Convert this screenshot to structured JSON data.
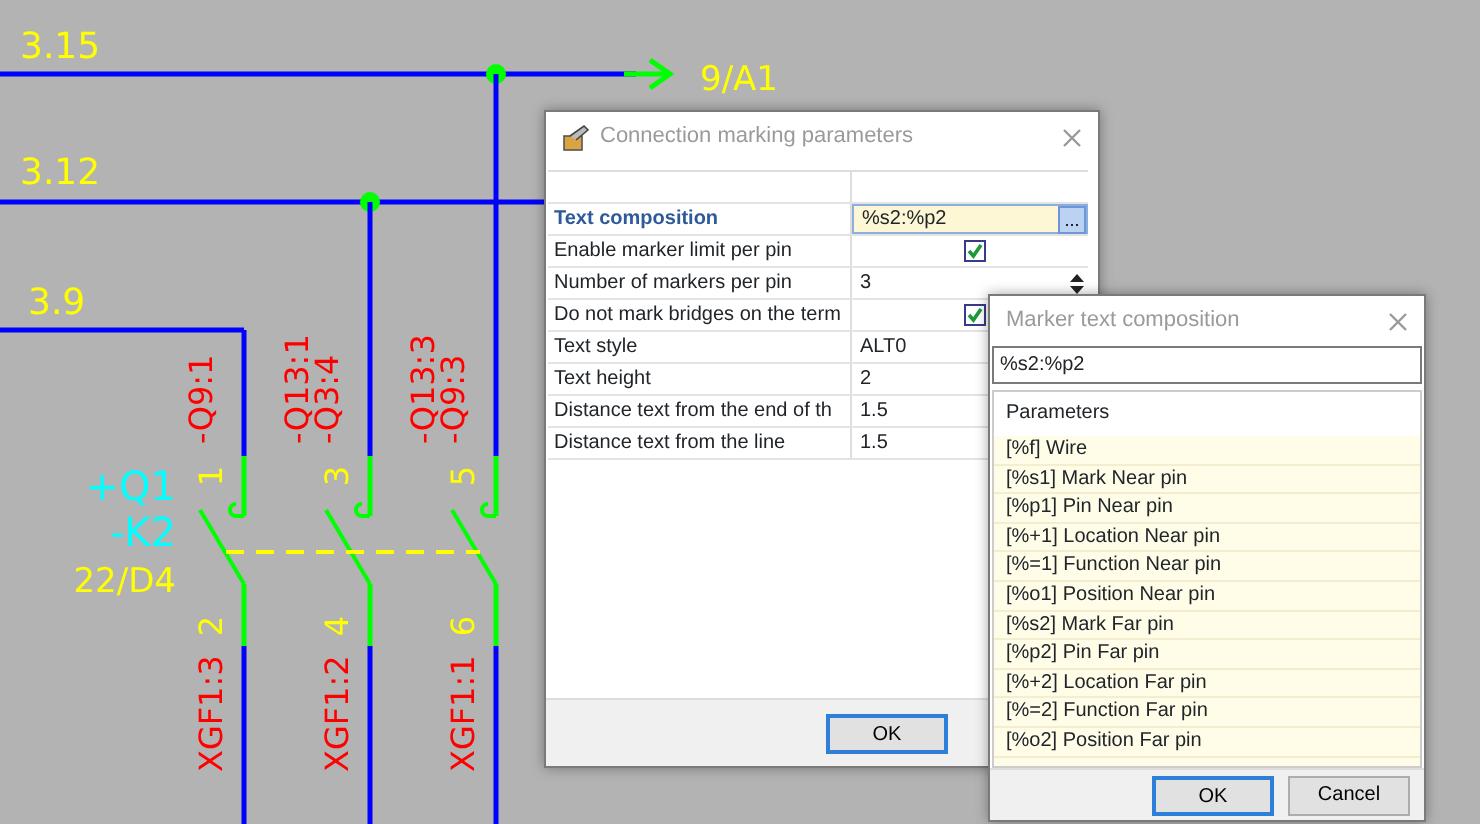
{
  "schematic": {
    "wire_labels": [
      "3.15",
      "3.12",
      "3.9"
    ],
    "cross_reference": "9/A1",
    "device": {
      "location": "+Q1",
      "name": "-K2",
      "reference": "22/D4"
    },
    "poles": [
      {
        "top_pin": "1",
        "bottom_pin": "2",
        "top_marks": [
          "-Q9:1"
        ],
        "bottom_mark": "XGF1:3"
      },
      {
        "top_pin": "3",
        "bottom_pin": "4",
        "top_marks": [
          "-Q13:1",
          "-Q3:4"
        ],
        "bottom_mark": "XGF1:2"
      },
      {
        "top_pin": "5",
        "bottom_pin": "6",
        "top_marks": [
          "-Q13:3",
          "-Q9:3"
        ],
        "bottom_mark": "XGF1:1"
      }
    ]
  },
  "parameters_dialog": {
    "title": "Connection marking parameters",
    "rows": [
      {
        "label": "Text composition",
        "value": "%s2:%p2",
        "kind": "text",
        "selected": true,
        "action_label": "..."
      },
      {
        "label": "Enable marker limit per pin",
        "kind": "checkbox",
        "checked": true,
        "selected": false
      },
      {
        "label": "Number of markers per pin",
        "value": "3",
        "kind": "spin",
        "selected": false
      },
      {
        "label": "Do not mark bridges on the term",
        "kind": "checkbox",
        "checked": true,
        "selected": false
      },
      {
        "label": "Text style",
        "value": "ALT0",
        "kind": "text",
        "selected": false
      },
      {
        "label": "Text height",
        "value": "2",
        "kind": "text",
        "selected": false
      },
      {
        "label": "Distance text from the end of th",
        "value": "1.5",
        "kind": "text",
        "selected": false
      },
      {
        "label": "Distance text from the line",
        "value": "1.5",
        "kind": "text",
        "selected": false
      }
    ],
    "buttons": [
      {
        "label": "OK",
        "default": true
      }
    ]
  },
  "composition_dialog": {
    "title": "Marker text composition",
    "value": "%s2:%p2",
    "list_header": "Parameters",
    "items": [
      "[%f] Wire",
      "[%s1] Mark Near pin",
      "[%p1] Pin Near pin",
      "[%+1] Location Near pin",
      "[%=1] Function Near pin",
      "[%o1] Position Near pin",
      "[%s2] Mark Far pin",
      "[%p2] Pin Far pin",
      "[%+2] Location Far pin",
      "[%=2] Function Far pin",
      "[%o2] Position Far pin"
    ],
    "buttons": [
      {
        "label": "OK",
        "default": true
      },
      {
        "label": "Cancel",
        "default": false
      }
    ]
  }
}
